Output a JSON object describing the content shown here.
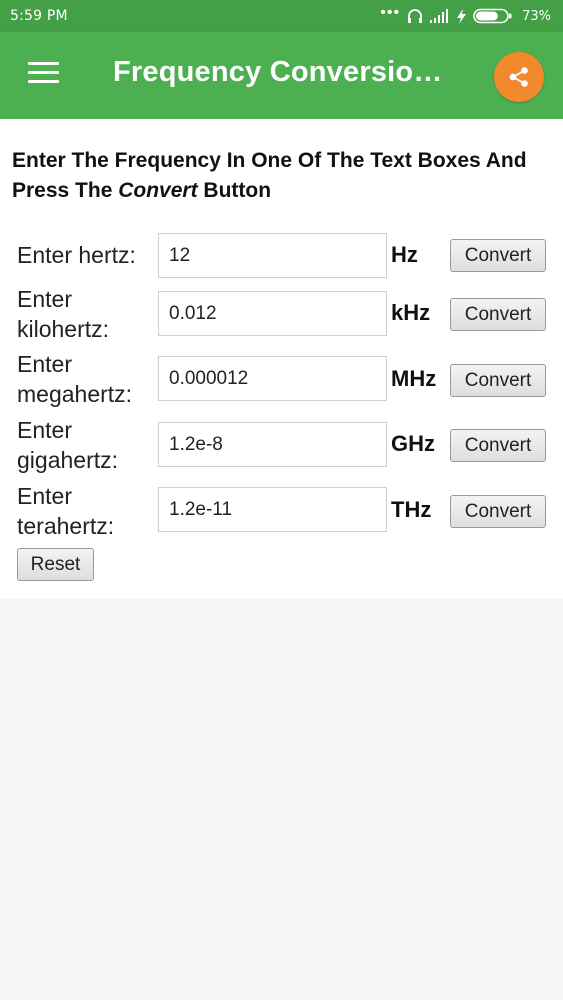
{
  "status_bar": {
    "time": "5:59 PM",
    "battery_percent": "73%",
    "battery_level": 0.73,
    "icons": [
      "more-dots-icon",
      "headphones-icon",
      "signal-icon",
      "charging-icon",
      "battery-icon"
    ]
  },
  "app_bar": {
    "title": "Frequency Conversion…",
    "menu_icon": "hamburger-menu-icon",
    "share_icon": "share-icon",
    "accent_color": "#4caf50",
    "share_color": "#f2892c"
  },
  "heading": {
    "line_before": "Enter The Frequency In One Of The Text Boxes And Press The ",
    "emphasis": "Convert",
    "line_after": " Button"
  },
  "rows": [
    {
      "label_line1": "Enter hertz:",
      "label_line2": "",
      "value": "12",
      "unit": "Hz",
      "button": "Convert"
    },
    {
      "label_line1": "Enter",
      "label_line2": "kilohertz:",
      "value": "0.012",
      "unit": "kHz",
      "button": "Convert"
    },
    {
      "label_line1": "Enter",
      "label_line2": "megahertz:",
      "value": "0.000012",
      "unit": "MHz",
      "button": "Convert"
    },
    {
      "label_line1": "Enter",
      "label_line2": "gigahertz:",
      "value": "1.2e-8",
      "unit": "GHz",
      "button": "Convert"
    },
    {
      "label_line1": "Enter",
      "label_line2": "terahertz:",
      "value": "1.2e-11",
      "unit": "THz",
      "button": "Convert"
    }
  ],
  "reset_label": "Reset"
}
